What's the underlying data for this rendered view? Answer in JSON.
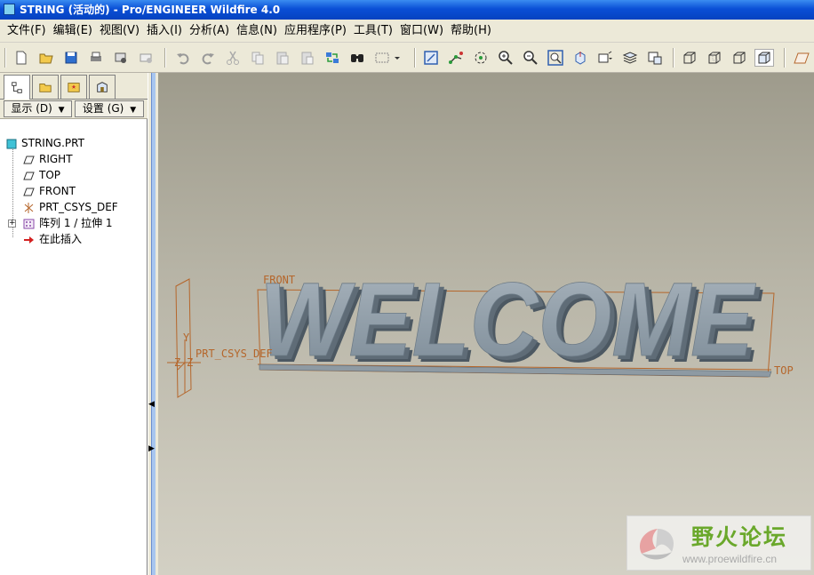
{
  "window": {
    "title": "STRING (活动的) - Pro/ENGINEER Wildfire 4.0"
  },
  "menu": [
    {
      "label": "文件(F)"
    },
    {
      "label": "编辑(E)"
    },
    {
      "label": "视图(V)"
    },
    {
      "label": "插入(I)"
    },
    {
      "label": "分析(A)"
    },
    {
      "label": "信息(N)"
    },
    {
      "label": "应用程序(P)"
    },
    {
      "label": "工具(T)"
    },
    {
      "label": "窗口(W)"
    },
    {
      "label": "帮助(H)"
    }
  ],
  "toolbar": {
    "icons": [
      "new-icon",
      "open-icon",
      "save-icon",
      "print-icon",
      "send-icon",
      "mail-icon",
      "undo-icon",
      "redo-icon",
      "cut-icon",
      "copy-icon",
      "paste-icon",
      "paste-special-icon",
      "regenerate-icon",
      "find-icon",
      "select-box-icon",
      "orient-icon",
      "sketch-icon",
      "spin-center-icon",
      "zoom-in-icon",
      "zoom-out-icon",
      "refit-icon",
      "reorient-icon",
      "saved-views-icon",
      "layers-icon",
      "view-manager-icon",
      "wireframe-icon",
      "hidden-line-icon",
      "no-hidden-icon",
      "shading-icon",
      "datum-plane-icon"
    ]
  },
  "panel": {
    "display_label": "显示",
    "display_key": "(D)",
    "settings_label": "设置",
    "settings_key": "(G)",
    "tree": [
      {
        "label": "STRING.PRT",
        "icon": "part-icon"
      },
      {
        "label": "RIGHT",
        "icon": "datum-plane-icon"
      },
      {
        "label": "TOP",
        "icon": "datum-plane-icon"
      },
      {
        "label": "FRONT",
        "icon": "datum-plane-icon"
      },
      {
        "label": "PRT_CSYS_DEF",
        "icon": "csys-icon"
      },
      {
        "label": "阵列 1 / 拉伸 1",
        "icon": "pattern-icon"
      },
      {
        "label": "在此插入",
        "icon": "insert-arrow-icon"
      }
    ]
  },
  "viewport": {
    "model_text": "WELCOME",
    "datum_front": "FRONT",
    "datum_top": "TOP",
    "datum_csys": "PRT_CSYS_DEF",
    "background_top": "#9e9b8c",
    "background_bottom": "#d3d0c4",
    "datum_color": "#b5662b",
    "model_color": "#7f8f9c"
  },
  "watermark": {
    "name": "野火论坛",
    "url": "www.proewildfire.cn"
  }
}
